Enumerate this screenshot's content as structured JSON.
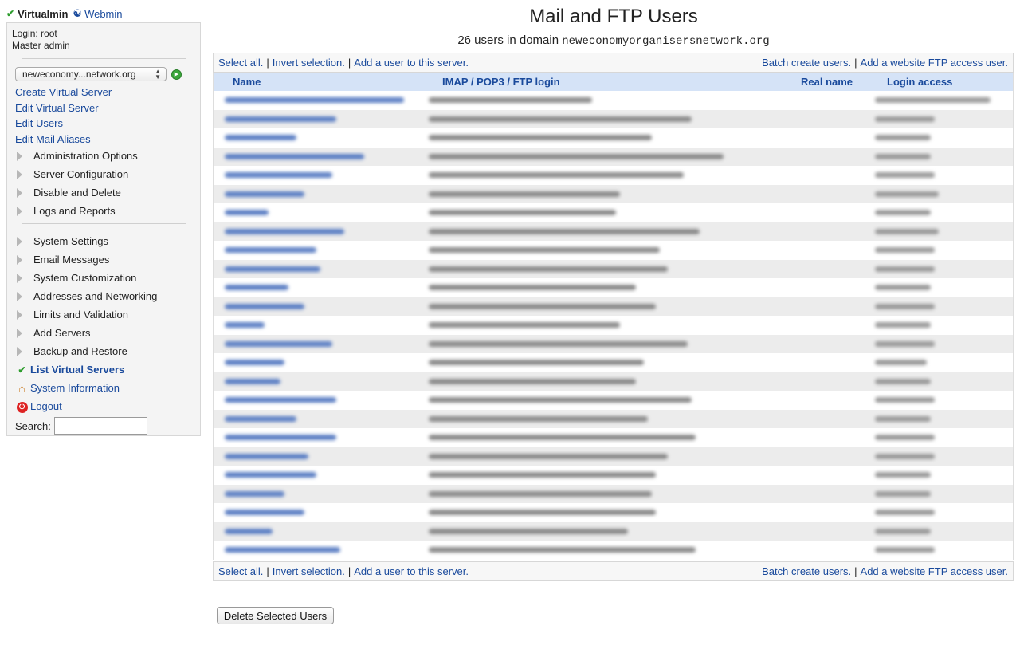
{
  "topbar": {
    "virtualmin": "Virtualmin",
    "webmin": "Webmin"
  },
  "sidebar": {
    "login": "Login: root",
    "role": "Master admin",
    "domain_select": "neweconomy...network.org",
    "links": [
      "Create Virtual Server",
      "Edit Virtual Server",
      "Edit Users",
      "Edit Mail Aliases"
    ],
    "categories_a": [
      "Administration Options",
      "Server Configuration",
      "Disable and Delete",
      "Logs and Reports"
    ],
    "categories_b": [
      "System Settings",
      "Email Messages",
      "System Customization",
      "Addresses and Networking",
      "Limits and Validation",
      "Add Servers",
      "Backup and Restore"
    ],
    "list_servers": "List Virtual Servers",
    "system_info": "System Information",
    "logout": "Logout",
    "search_label": "Search:"
  },
  "main": {
    "title": "Mail and FTP Users",
    "subtitle_prefix": "26 users in domain",
    "domain": "neweconomyorganisersnetwork.org",
    "actions_left": [
      "Select all.",
      "Invert selection.",
      "Add a user to this server."
    ],
    "actions_right": [
      "Batch create users.",
      "Add a website FTP access user."
    ],
    "columns": [
      "Name",
      "IMAP / POP3 / FTP login",
      "Real name",
      "Login access"
    ],
    "delete_button": "Delete Selected Users"
  },
  "colors": {
    "link": "#1a4a9c",
    "header_bg": "#d5e3f7",
    "accent_green": "#2e9d2e"
  }
}
